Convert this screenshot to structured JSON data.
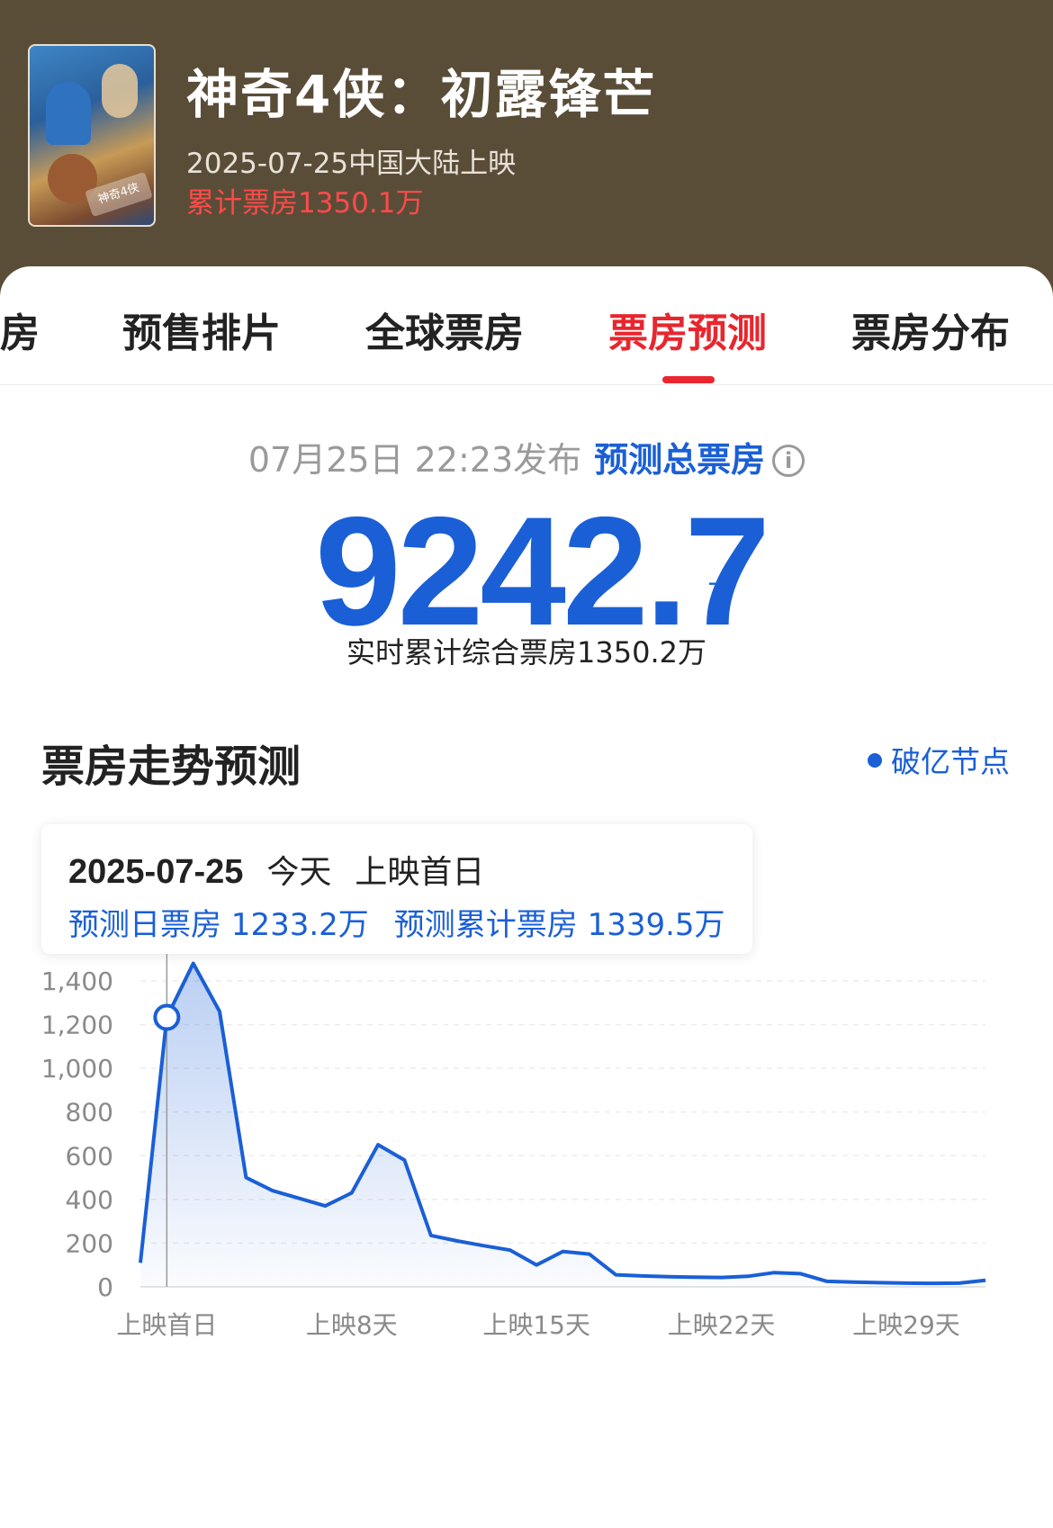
{
  "movie": {
    "title": "神奇4侠：初露锋芒",
    "release": "2025-07-25中国大陆上映",
    "cumulative": "累计票房1350.1万",
    "poster_text": "神奇4侠"
  },
  "tabs": [
    {
      "label": "房",
      "active": false
    },
    {
      "label": "预售排片",
      "active": false
    },
    {
      "label": "全球票房",
      "active": false
    },
    {
      "label": "票房预测",
      "active": true
    },
    {
      "label": "票房分布",
      "active": false
    }
  ],
  "forecast": {
    "publish_time": "07月25日 22:23发布",
    "label": "预测总票房",
    "info_icon": "info-icon",
    "value": "9242.7",
    "unit": "万",
    "realtime": "实时累计综合票房1350.2万"
  },
  "trend": {
    "title": "票房走势预测",
    "legend": "破亿节点"
  },
  "tooltip": {
    "date": "2025-07-25",
    "today": "今天",
    "day_label": "上映首日",
    "daily": "预测日票房 1233.2万",
    "cumulative": "预测累计票房 1339.5万"
  },
  "colors": {
    "accent_red": "#e8262e",
    "blue": "#1a5fd6",
    "header_bg": "#5a4d38"
  },
  "chart_data": {
    "type": "area",
    "x": [
      0,
      1,
      2,
      3,
      4,
      5,
      6,
      7,
      8,
      9,
      10,
      11,
      12,
      13,
      14,
      15,
      16,
      17,
      18,
      19,
      20,
      21,
      22,
      23,
      24,
      25,
      26,
      27,
      28,
      29,
      30,
      31,
      32
    ],
    "values": [
      110,
      1233,
      1480,
      1260,
      500,
      440,
      405,
      370,
      430,
      650,
      580,
      235,
      210,
      188,
      168,
      100,
      162,
      150,
      55,
      50,
      46,
      44,
      43,
      48,
      65,
      60,
      25,
      22,
      19,
      17,
      16,
      17,
      30
    ],
    "selected_index": 1,
    "yticks": [
      "1,400",
      "1,200",
      "1,000",
      "800",
      "600",
      "400",
      "200",
      "0"
    ],
    "ylim": [
      0,
      1400
    ],
    "xticks": [
      {
        "label": "上映首日",
        "index": 1
      },
      {
        "label": "上映8天",
        "index": 8
      },
      {
        "label": "上映15天",
        "index": 15
      },
      {
        "label": "上映22天",
        "index": 22
      },
      {
        "label": "上映29天",
        "index": 29
      }
    ],
    "grid": true
  }
}
